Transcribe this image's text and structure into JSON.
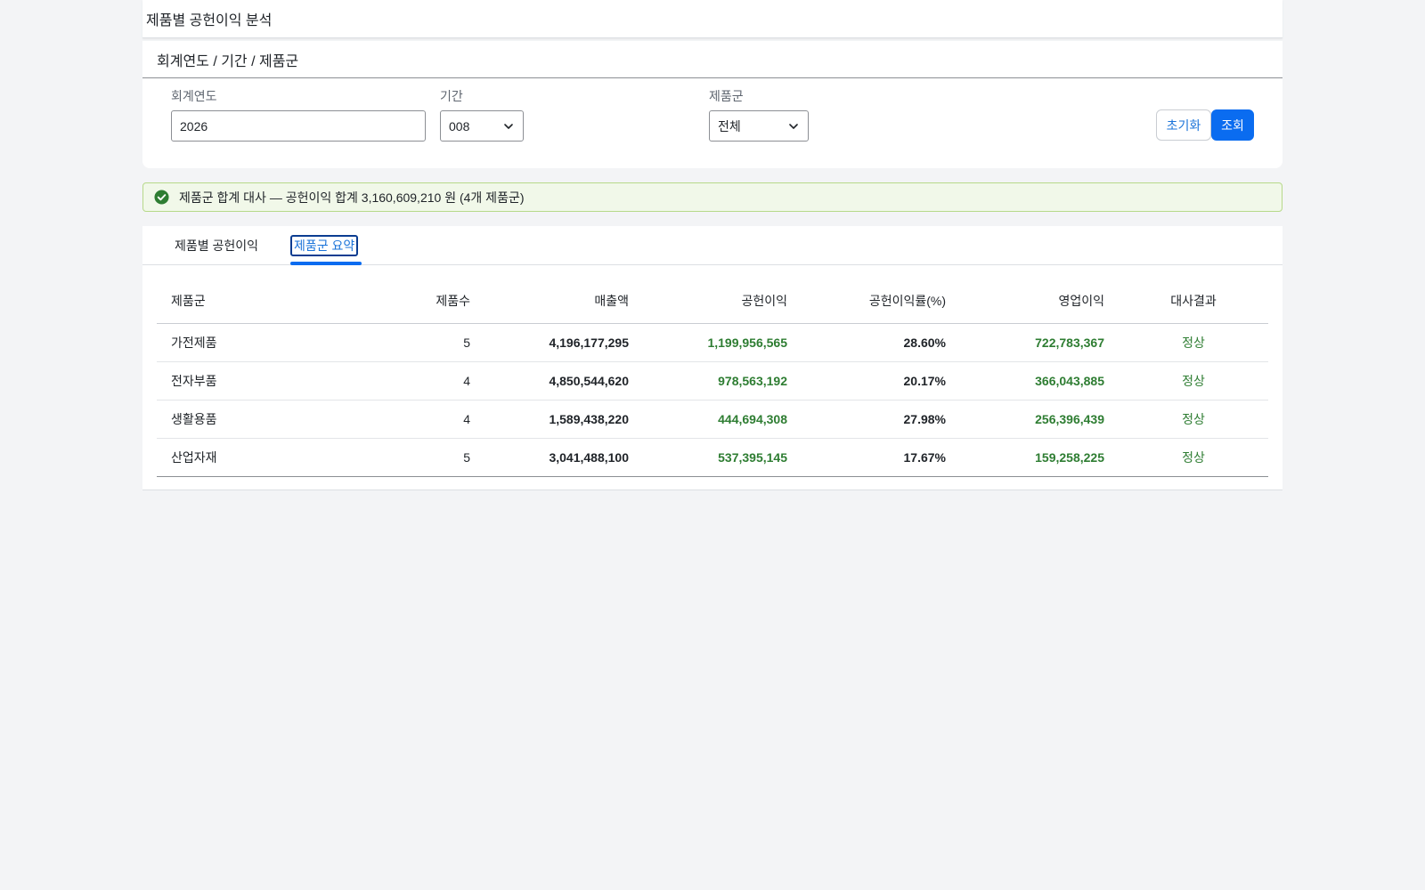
{
  "app": {
    "title": "제품별 공헌이익 분석"
  },
  "filter": {
    "header": "회계연도 / 기간 / 제품군",
    "fiscal_year_label": "회계연도",
    "fiscal_year_value": "2026",
    "period_label": "기간",
    "period_value": "008",
    "group_label": "제품군",
    "group_value": "전체",
    "reset_label": "초기화",
    "search_label": "조회"
  },
  "notice": {
    "text": "제품군 합계 대사 — 공헌이익 합계 3,160,609,210 원 (4개 제품군)"
  },
  "tabs": [
    {
      "label": "제품별 공헌이익"
    },
    {
      "label": "제품군 요약"
    }
  ],
  "table": {
    "headers": {
      "group": "제품군",
      "count": "제품수",
      "sales": "매출액",
      "contribution": "공헌이익",
      "rate": "공헌이익률(%)",
      "operating": "영업이익",
      "result": "대사결과"
    },
    "rows": [
      {
        "group": "가전제품",
        "count": "5",
        "sales": "4,196,177,295",
        "contribution": "1,199,956,565",
        "rate": "28.60%",
        "operating": "722,783,367",
        "result": "정상"
      },
      {
        "group": "전자부품",
        "count": "4",
        "sales": "4,850,544,620",
        "contribution": "978,563,192",
        "rate": "20.17%",
        "operating": "366,043,885",
        "result": "정상"
      },
      {
        "group": "생활용품",
        "count": "4",
        "sales": "1,589,438,220",
        "contribution": "444,694,308",
        "rate": "27.98%",
        "operating": "256,396,439",
        "result": "정상"
      },
      {
        "group": "산업자재",
        "count": "5",
        "sales": "3,041,488,100",
        "contribution": "537,395,145",
        "rate": "17.67%",
        "operating": "159,258,225",
        "result": "정상"
      }
    ]
  },
  "colors": {
    "accent": "#0a6cf0",
    "positive": "#2e7d32",
    "notice_bg": "#f1f8e9"
  }
}
